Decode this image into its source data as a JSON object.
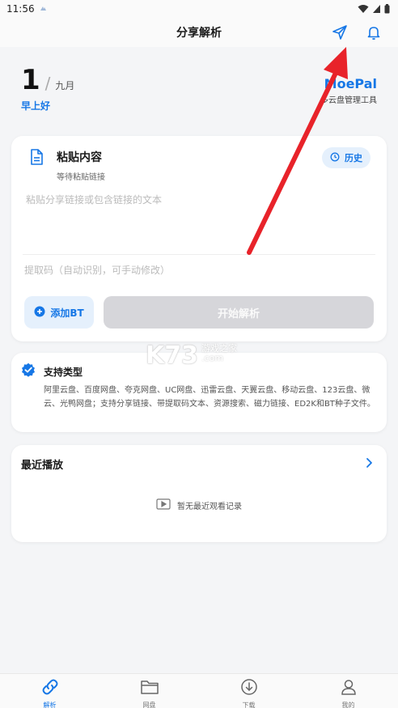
{
  "status_bar": {
    "time": "11:56"
  },
  "header": {
    "title": "分享解析",
    "share_icon": "send-icon",
    "bell_icon": "bell-icon"
  },
  "date": {
    "day": "1",
    "separator": "/",
    "month": "九月",
    "greeting": "早上好"
  },
  "brand": {
    "name": "MoePal",
    "tagline": "多云盘管理工具"
  },
  "paste_card": {
    "title": "粘贴内容",
    "subtitle": "等待粘贴链接",
    "history_label": "历史",
    "link_placeholder": "粘贴分享链接或包含链接的文本",
    "code_placeholder": "提取码（自动识别，可手动修改）",
    "add_bt_label": "添加BT",
    "start_label": "开始解析"
  },
  "support_card": {
    "title": "支持类型",
    "text": "阿里云盘、百度网盘、夸克网盘、UC网盘、迅雷云盘、天翼云盘、移动云盘、123云盘、微云、光鸭网盘；支持分享链接、带提取码文本、资源搜索、磁力链接、ED2K和BT种子文件。"
  },
  "recent_card": {
    "title": "最近播放",
    "empty_text": "暂无最近观看记录"
  },
  "watermark": {
    "logo": "K73",
    "line1": "游戏之家",
    "line2": ".com"
  },
  "bottom_nav": {
    "items": [
      {
        "label": "解析",
        "icon": "link-icon",
        "active": true
      },
      {
        "label": "网盘",
        "icon": "folder-icon",
        "active": false
      },
      {
        "label": "下载",
        "icon": "download-icon",
        "active": false
      },
      {
        "label": "我的",
        "icon": "user-icon",
        "active": false
      }
    ]
  },
  "colors": {
    "accent": "#1677e6",
    "background": "#f4f5f7",
    "annotation_arrow": "#e8232a"
  }
}
